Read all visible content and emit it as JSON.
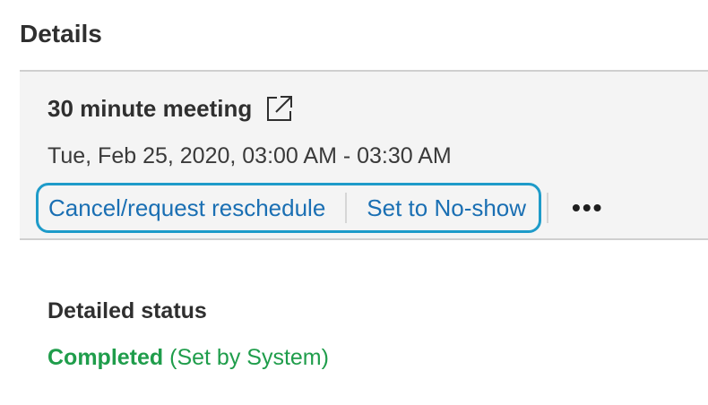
{
  "section": {
    "title": "Details"
  },
  "meeting": {
    "title": "30 minute meeting",
    "external_icon": "external-link-icon",
    "time": "Tue, Feb 25, 2020, 03:00 AM - 03:30 AM"
  },
  "actions": {
    "cancel_label": "Cancel/request reschedule",
    "noshow_label": "Set to No-show",
    "more_label": "•••"
  },
  "status": {
    "label": "Detailed status",
    "value": "Completed",
    "note": " (Set by System)",
    "value_color": "#1f9d4b"
  },
  "colors": {
    "link": "#1a6fb3",
    "focus_ring": "#1e9bc9",
    "card_bg": "#f4f4f4"
  }
}
